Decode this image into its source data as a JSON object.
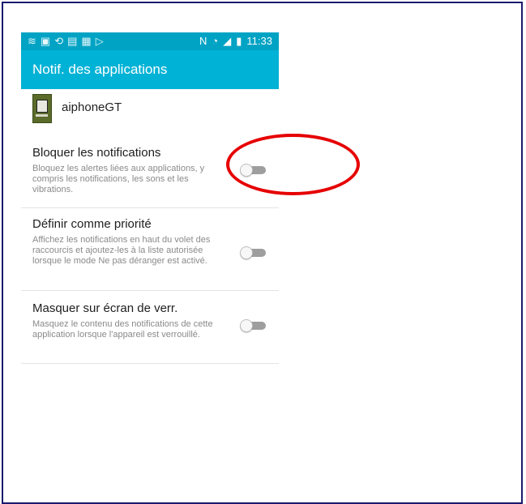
{
  "status_bar": {
    "left_icons": [
      "wifi-icon",
      "image-icon",
      "sync-icon",
      "calendar-icon",
      "gallery-icon",
      "play-icon"
    ],
    "right_icons": [
      "nfc-icon",
      "wifi-signal-icon",
      "cell-signal-icon",
      "battery-icon"
    ],
    "time": "11:33"
  },
  "app_bar": {
    "title": "Notif. des applications"
  },
  "app": {
    "name": "aiphoneGT"
  },
  "settings": [
    {
      "title": "Bloquer les notifications",
      "description": "Bloquez les alertes liées aux applications, y compris les notifications, les sons et les vibrations.",
      "enabled": false
    },
    {
      "title": "Définir comme priorité",
      "description": "Affichez les notifications en haut du volet des raccourcis et ajoutez-les à la liste autorisée lorsque le mode Ne pas déranger est activé.",
      "enabled": false
    },
    {
      "title": "Masquer sur écran de verr.",
      "description": "Masquez le contenu des notifications de cette application lorsque l'appareil est verrouillé.",
      "enabled": false
    }
  ],
  "colors": {
    "status_bar": "#00a3c4",
    "app_bar": "#00b2d6",
    "annotation": "#e60000"
  }
}
